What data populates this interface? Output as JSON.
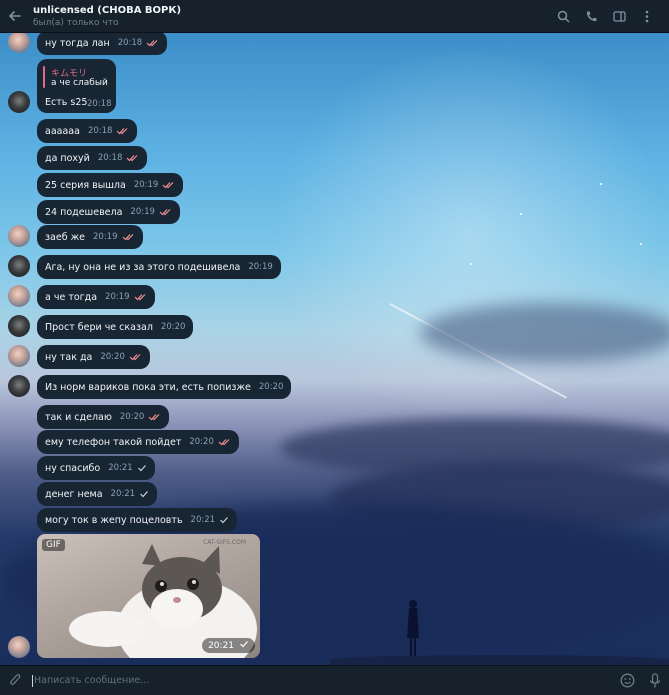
{
  "header": {
    "title": "unlicensed (СНОВА ВОРК)",
    "status": "был(а) только что"
  },
  "icons": {
    "back": "arrow-left-icon",
    "search": "search-icon",
    "call": "phone-icon",
    "sidebar": "sidebar-toggle-icon",
    "more": "more-vertical-icon",
    "attach": "paperclip-icon",
    "emoji": "emoji-icon",
    "mic": "microphone-icon"
  },
  "messages": [
    {
      "text": "ну тогда лан",
      "time": "20:18",
      "read": true
    },
    {
      "text": "Есть s25",
      "time": "20:18",
      "reply_name": "キムモリ",
      "reply_text": "а че слабый"
    },
    {
      "text": "аааааа",
      "time": "20:18",
      "read": true
    },
    {
      "text": "да похуй",
      "time": "20:18",
      "read": true
    },
    {
      "text": "25 серия вышла",
      "time": "20:19",
      "read": true
    },
    {
      "text": "24 подешевела",
      "time": "20:19",
      "read": true
    },
    {
      "text": "заеб же",
      "time": "20:19",
      "read": true
    },
    {
      "text": "Ага, ну она не из за этого подешивела",
      "time": "20:19"
    },
    {
      "text": "а че тогда",
      "time": "20:19",
      "read": true
    },
    {
      "text": "Прост бери че сказал",
      "time": "20:20"
    },
    {
      "text": "ну так да",
      "time": "20:20",
      "read": true
    },
    {
      "text": "Из норм вариков пока эти, есть попизже",
      "time": "20:20"
    },
    {
      "text": "так и сделаю",
      "time": "20:20",
      "read": true
    },
    {
      "text": "ему телефон такой пойдет",
      "time": "20:20",
      "read": true
    },
    {
      "text": "ну спасибо",
      "time": "20:21",
      "read": false
    },
    {
      "text": "денег нема",
      "time": "20:21",
      "read": false
    },
    {
      "text": "могу ток в жепу поцеловть",
      "time": "20:21",
      "read": false
    }
  ],
  "gif": {
    "badge": "GIF",
    "watermark": "CAT-GIFS.COM",
    "time": "20:21"
  },
  "composer": {
    "placeholder": "Написать сообщение..."
  },
  "colors": {
    "bubble": "#182533",
    "header": "#17212b",
    "read_check": "#f08f8f",
    "reply_accent": "#e06c8a"
  }
}
